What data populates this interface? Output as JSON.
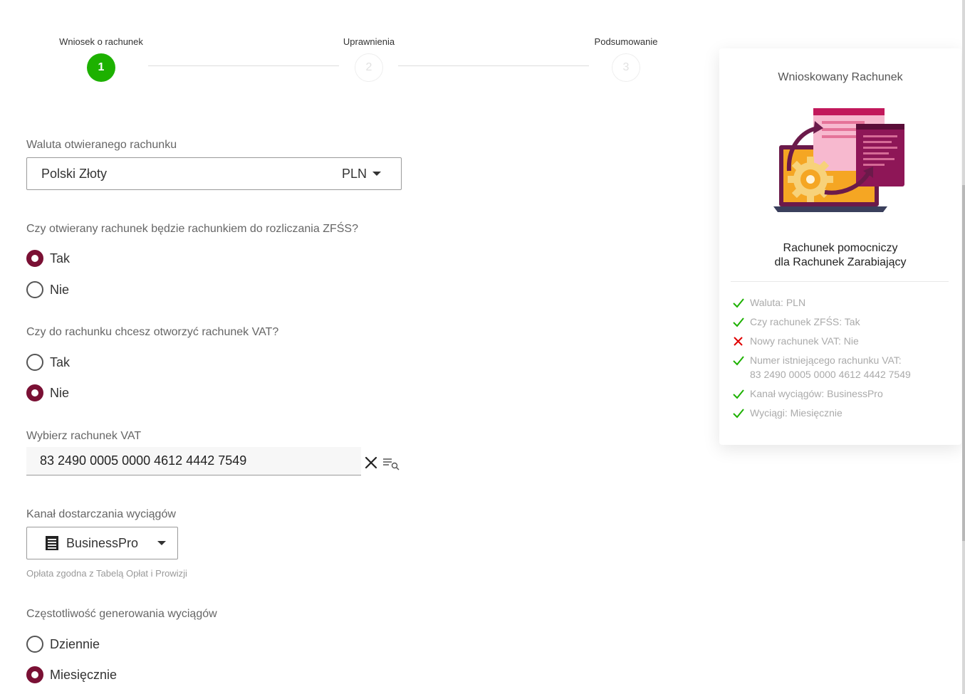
{
  "stepper": {
    "steps": [
      {
        "label": "Wniosek o rachunek",
        "number": "1",
        "state": "active"
      },
      {
        "label": "Uprawnienia",
        "number": "2",
        "state": "inactive"
      },
      {
        "label": "Podsumowanie",
        "number": "3",
        "state": "inactive"
      }
    ]
  },
  "form": {
    "currency": {
      "label": "Waluta otwieranego rachunku",
      "value_name": "Polski Złoty",
      "value_code": "PLN"
    },
    "zfss": {
      "question": "Czy otwierany rachunek będzie rachunkiem do rozliczania ZFŚS?",
      "options": [
        "Tak",
        "Nie"
      ],
      "selected": "Tak"
    },
    "vat": {
      "question": "Czy do rachunku chcesz otworzyć rachunek VAT?",
      "options": [
        "Tak",
        "Nie"
      ],
      "selected": "Nie"
    },
    "vat_account": {
      "label": "Wybierz rachunek VAT",
      "value": "83 2490 0005 0000 4612 4442 7549"
    },
    "channel": {
      "label": "Kanał dostarczania wyciągów",
      "value": "BusinessPro",
      "hint": "Opłata zgodna z Tabelą Opłat i Prowizji"
    },
    "frequency": {
      "label": "Częstotliwość generowania wyciągów",
      "options": [
        "Dziennie",
        "Miesięcznie"
      ],
      "selected": "Miesięcznie"
    }
  },
  "summary": {
    "title": "Wnioskowany Rachunek",
    "subtitle_line1": "Rachunek pomocniczy",
    "subtitle_line2": "dla Rachunek Zarabiający",
    "items": [
      {
        "text": "Waluta: PLN",
        "ok": true
      },
      {
        "text": "Czy rachunek ZFŚS: Tak",
        "ok": true
      },
      {
        "text": "Nowy rachunek VAT: Nie",
        "ok": false
      },
      {
        "text": "Numer istniejącego rachunku VAT:",
        "text2": "83 2490 0005 0000 4612 4442 7549",
        "ok": true
      },
      {
        "text": "Kanał wyciągów: BusinessPro",
        "ok": true
      },
      {
        "text": "Wyciągi: Miesięcznie",
        "ok": true
      }
    ]
  },
  "colors": {
    "accent": "#7a1034",
    "step_active": "#1db100",
    "check": "#1db100",
    "cross": "#e00000"
  }
}
